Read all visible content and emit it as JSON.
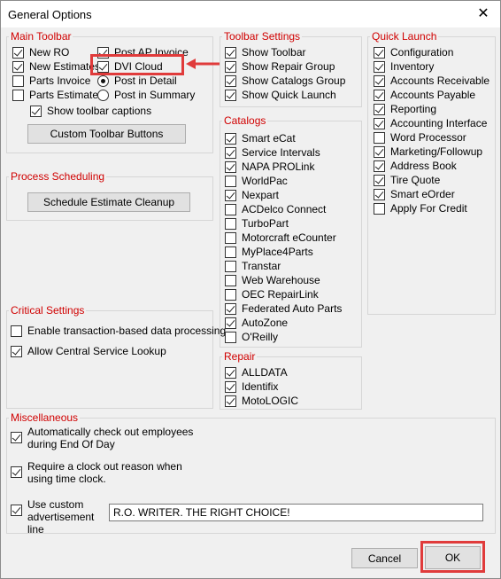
{
  "window": {
    "title": "General Options"
  },
  "main_toolbar": {
    "legend": "Main Toolbar",
    "new_ro": "New RO",
    "new_estimates": "New Estimates",
    "parts_invoice": "Parts Invoice",
    "parts_estimate": "Parts Estimate",
    "post_ap_invoice": "Post AP Invoice",
    "dvi_cloud": "DVI Cloud",
    "post_in_detail": "Post in Detail",
    "post_in_summary": "Post in Summary",
    "show_toolbar_captions": "Show toolbar captions",
    "custom_button": "Custom Toolbar Buttons"
  },
  "process_scheduling": {
    "legend": "Process Scheduling",
    "cleanup_button": "Schedule Estimate Cleanup"
  },
  "critical_settings": {
    "legend": "Critical Settings",
    "transaction_processing": "Enable transaction-based data processing",
    "central_service": "Allow Central Service Lookup"
  },
  "toolbar_settings": {
    "legend": "Toolbar Settings",
    "items": [
      "Show Toolbar",
      "Show Repair Group",
      "Show Catalogs Group",
      "Show Quick Launch"
    ]
  },
  "catalogs": {
    "legend": "Catalogs",
    "items": [
      "Smart eCat",
      "Service Intervals",
      "NAPA PROLink",
      "WorldPac",
      "Nexpart",
      "ACDelco Connect",
      "TurboPart",
      "Motorcraft eCounter",
      "MyPlace4Parts",
      "Transtar",
      "Web Warehouse",
      "OEC RepairLink",
      "Federated Auto Parts",
      "AutoZone",
      "O'Reilly"
    ]
  },
  "repair": {
    "legend": "Repair",
    "items": [
      "ALLDATA",
      "Identifix",
      "MotoLOGIC"
    ]
  },
  "quick_launch": {
    "legend": "Quick Launch",
    "items": [
      "Configuration",
      "Inventory",
      "Accounts Receivable",
      "Accounts Payable",
      "Reporting",
      "Accounting Interface",
      "Word Processor",
      "Marketing/Followup",
      "Address Book",
      "Tire Quote",
      "Smart eOrder",
      "Apply For Credit"
    ]
  },
  "miscellaneous": {
    "legend": "Miscellaneous",
    "auto_checkout": "Automatically check out employees during End Of Day",
    "clock_out_reason": "Require a clock out reason when using time clock.",
    "custom_ad": "Use custom advertisement line",
    "ad_value": "R.O. WRITER. THE RIGHT CHOICE!"
  },
  "buttons": {
    "cancel": "Cancel",
    "ok": "OK"
  },
  "colors": {
    "legend": "#d00000",
    "highlight": "#e03b3b"
  }
}
